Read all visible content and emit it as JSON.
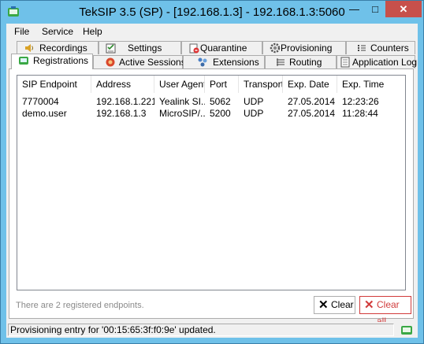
{
  "window": {
    "title": "TekSIP 3.5 (SP) - [192.168.1.3] - 192.168.1.3:5060"
  },
  "colors": {
    "title_bar": "#6fc1e9",
    "close_button": "#c7504b",
    "clear_all_border": "#d13b3b"
  },
  "menu": [
    {
      "label": "File"
    },
    {
      "label": "Service"
    },
    {
      "label": "Help"
    }
  ],
  "tabs_row1": [
    {
      "label": "Recordings",
      "icon": "speaker-icon"
    },
    {
      "label": "Settings",
      "icon": "checklist-icon"
    },
    {
      "label": "Quarantine",
      "icon": "quarantine-icon"
    },
    {
      "label": "Provisioning",
      "icon": "gear-icon"
    },
    {
      "label": "Counters",
      "icon": "list-icon"
    }
  ],
  "tabs_row2": [
    {
      "label": "Registrations",
      "icon": "registration-icon",
      "active": true
    },
    {
      "label": "Active Sessions",
      "icon": "session-icon"
    },
    {
      "label": "Extensions",
      "icon": "extensions-icon"
    },
    {
      "label": "Routing",
      "icon": "routing-icon"
    },
    {
      "label": "Application Log",
      "icon": "log-icon"
    }
  ],
  "table": {
    "columns": [
      "SIP Endpoint",
      "Address",
      "User Agent",
      "Port",
      "Transport",
      "Exp. Date",
      "Exp. Time"
    ],
    "rows": [
      [
        "7770004",
        "192.168.1.221",
        "Yealink SI...",
        "5062",
        "UDP",
        "27.05.2014",
        "12:23:26"
      ],
      [
        "demo.user",
        "192.168.1.3",
        "MicroSIP/...",
        "5200",
        "UDP",
        "27.05.2014",
        "11:28:44"
      ]
    ]
  },
  "footer": {
    "summary": "There are 2 registered endpoints."
  },
  "buttons": {
    "clear": "Clear",
    "clear_all": "Clear all"
  },
  "statusbar": {
    "message": "Provisioning entry for '00:15:65:3f:f0:9e' updated."
  }
}
